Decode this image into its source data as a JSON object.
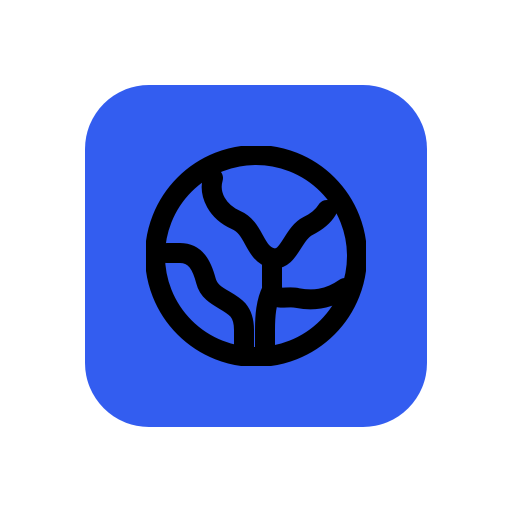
{
  "icon": {
    "name": "globe-icon",
    "tile_color": "#335DF0",
    "glyph_color": "#000000"
  }
}
